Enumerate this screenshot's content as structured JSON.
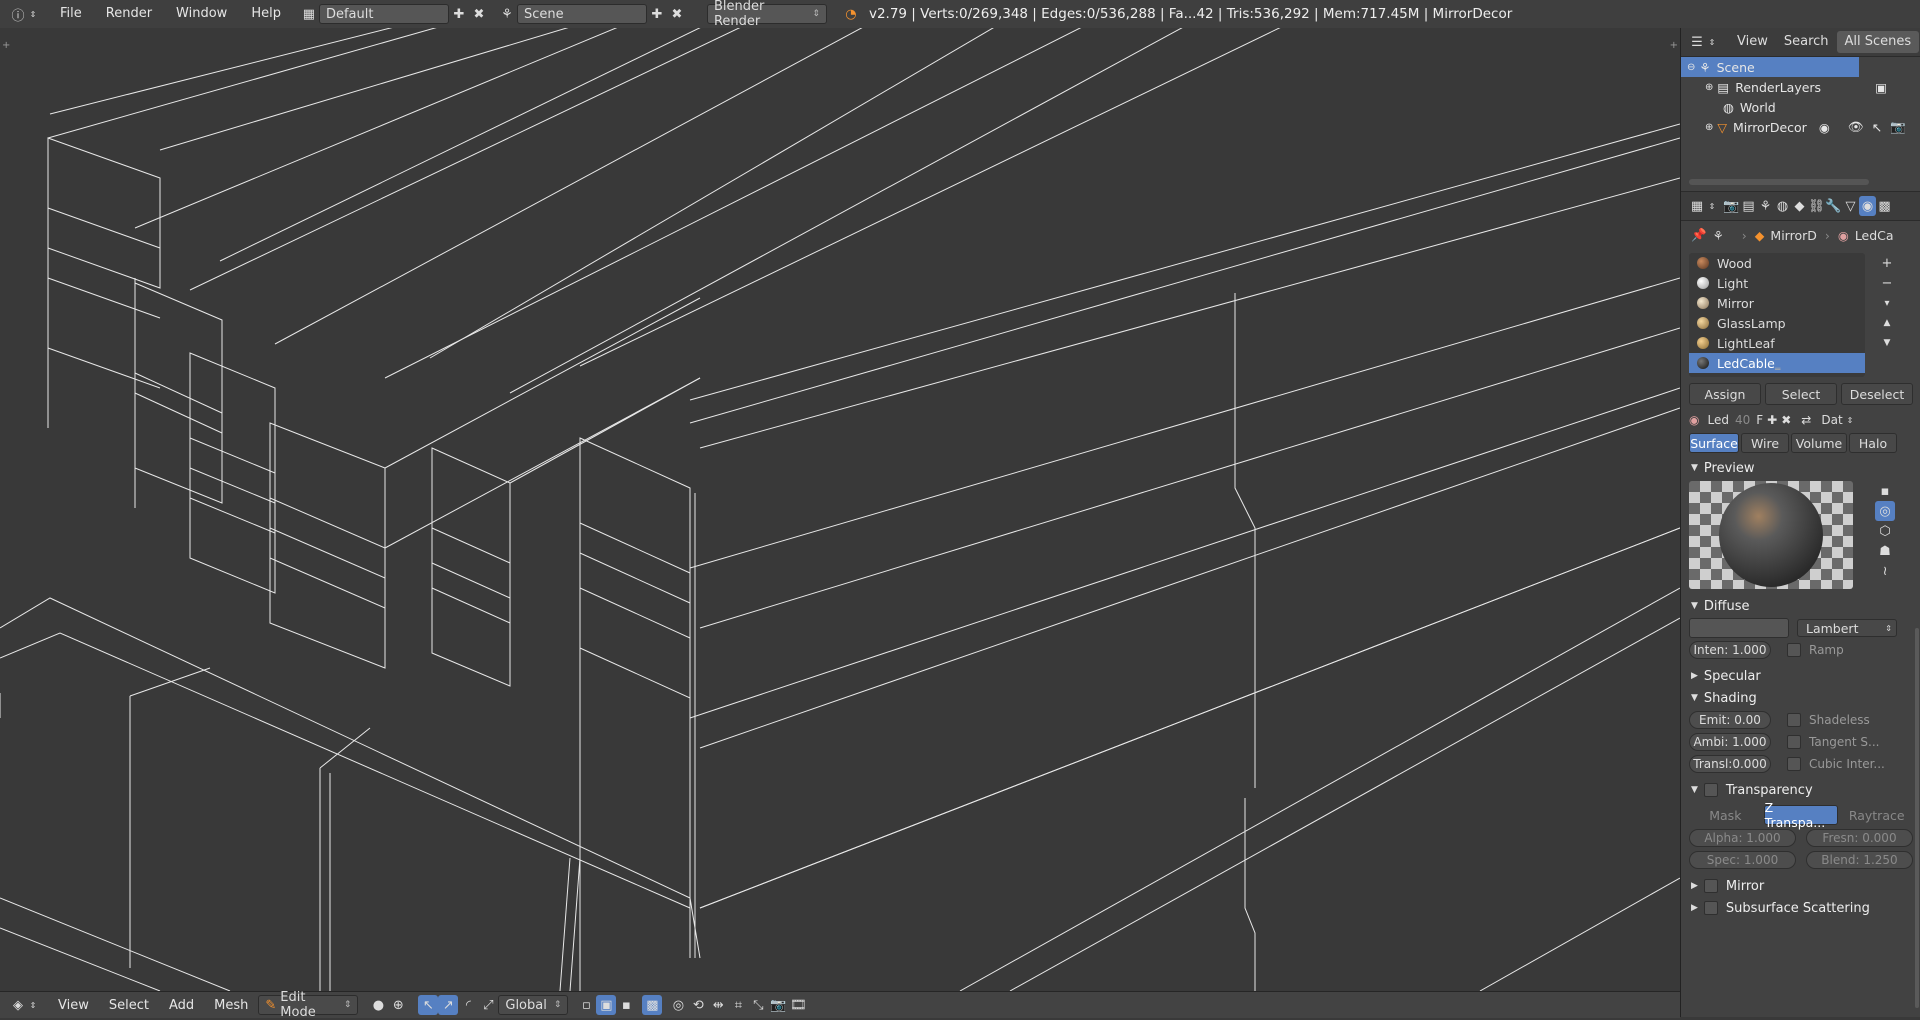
{
  "topbar": {
    "menus": [
      "File",
      "Render",
      "Window",
      "Help"
    ],
    "layout": "Default",
    "scene": "Scene",
    "engine": "Blender Render",
    "stats": "v2.79 | Verts:0/269,348 | Edges:0/536,288 | Fa...42 | Tris:536,292 | Mem:717.45M | MirrorDecor"
  },
  "bottombar": {
    "menus": [
      "View",
      "Select",
      "Add",
      "Mesh"
    ],
    "mode": "Edit Mode",
    "orientation": "Global"
  },
  "outliner": {
    "tabs": [
      "View",
      "Search",
      "All Scenes"
    ],
    "items": [
      {
        "label": "Scene"
      },
      {
        "label": "RenderLayers"
      },
      {
        "label": "World"
      },
      {
        "label": "MirrorDecor"
      }
    ]
  },
  "properties": {
    "breadcrumb": [
      "MirrorD",
      "LedCa"
    ],
    "materials": [
      {
        "name": "Wood",
        "color": "#8a5a3a"
      },
      {
        "name": "Light",
        "color": "#e8e8e8"
      },
      {
        "name": "Mirror",
        "color": "#d9c7a8"
      },
      {
        "name": "GlassLamp",
        "color": "#d8b880"
      },
      {
        "name": "LightLeaf",
        "color": "#d8b070"
      },
      {
        "name": "LedCable",
        "color": "#2a2a2a"
      }
    ],
    "buttons": {
      "assign": "Assign",
      "select": "Select",
      "deselect": "Deselect"
    },
    "slot": {
      "name": "Led",
      "users": "40",
      "fake": "F",
      "data": "Dat"
    },
    "mat_tabs": [
      "Surface",
      "Wire",
      "Volume",
      "Halo"
    ],
    "sections": {
      "preview": "Preview",
      "diffuse": "Diffuse",
      "specular": "Specular",
      "shading": "Shading",
      "transparency": "Transparency",
      "mirror": "Mirror",
      "sss": "Subsurface Scattering"
    },
    "diffuse": {
      "shader": "Lambert",
      "intensity": "Inten: 1.000",
      "ramp": "Ramp"
    },
    "shading": {
      "emit": "Emit: 0.00",
      "ambi": "Ambi: 1.000",
      "transl": "Transl:0.000",
      "shadeless": "Shadeless",
      "tangent": "Tangent S...",
      "cubic": "Cubic Inter..."
    },
    "transparency": {
      "modes": [
        "Mask",
        "Z Transpa...",
        "Raytrace"
      ],
      "alpha": "Alpha: 1.000",
      "fresnel": "Fresn: 0.000",
      "spec": "Spec: 1.000",
      "blend": "Blend: 1.250"
    }
  },
  "colors": {
    "accent": "#5680c2",
    "bg": "#393939",
    "wire": "#e6e6e6"
  }
}
